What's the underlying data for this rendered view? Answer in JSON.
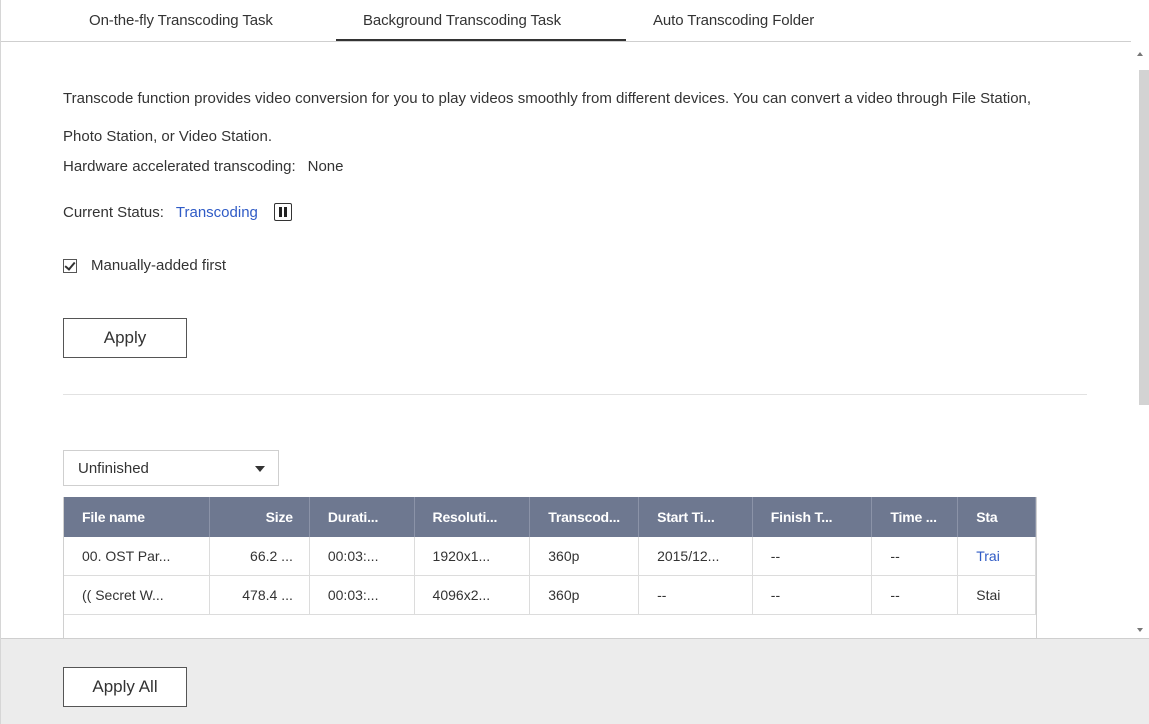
{
  "tabs": [
    {
      "label": "On-the-fly Transcoding Task"
    },
    {
      "label": "Background Transcoding Task"
    },
    {
      "label": "Auto Transcoding Folder"
    }
  ],
  "active_tab": "Background Transcoding Task",
  "description": "Transcode function provides video conversion for you to play videos smoothly from different devices. You can convert a video through File Station, Photo Station, or Video Station.",
  "hardware": {
    "label": "Hardware accelerated transcoding:",
    "value": "None"
  },
  "status": {
    "label": "Current Status:",
    "value": "Transcoding",
    "pause_icon": "pause-icon"
  },
  "manual_first": {
    "label": "Manually-added first",
    "checked": true
  },
  "apply_label": "Apply",
  "filter": {
    "selected": "Unfinished"
  },
  "table": {
    "columns": [
      "File name",
      "Size",
      "Durati...",
      "Resoluti...",
      "Transcod...",
      "Start Ti...",
      "Finish T...",
      "Time ...",
      "Sta"
    ],
    "rows": [
      [
        "00. OST Par...",
        "66.2 ...",
        "00:03:...",
        "1920x1...",
        "360p",
        "2015/12...",
        "--",
        "--",
        "Trai"
      ],
      [
        "(( Secret W...",
        "478.4 ...",
        "00:03:...",
        "4096x2...",
        "360p",
        "--",
        "--",
        "--",
        "Stai"
      ]
    ]
  },
  "apply_all_label": "Apply All",
  "colors": {
    "header_bg": "#6e7890",
    "link": "#2f5bc6",
    "footer_bg": "#ececec"
  }
}
